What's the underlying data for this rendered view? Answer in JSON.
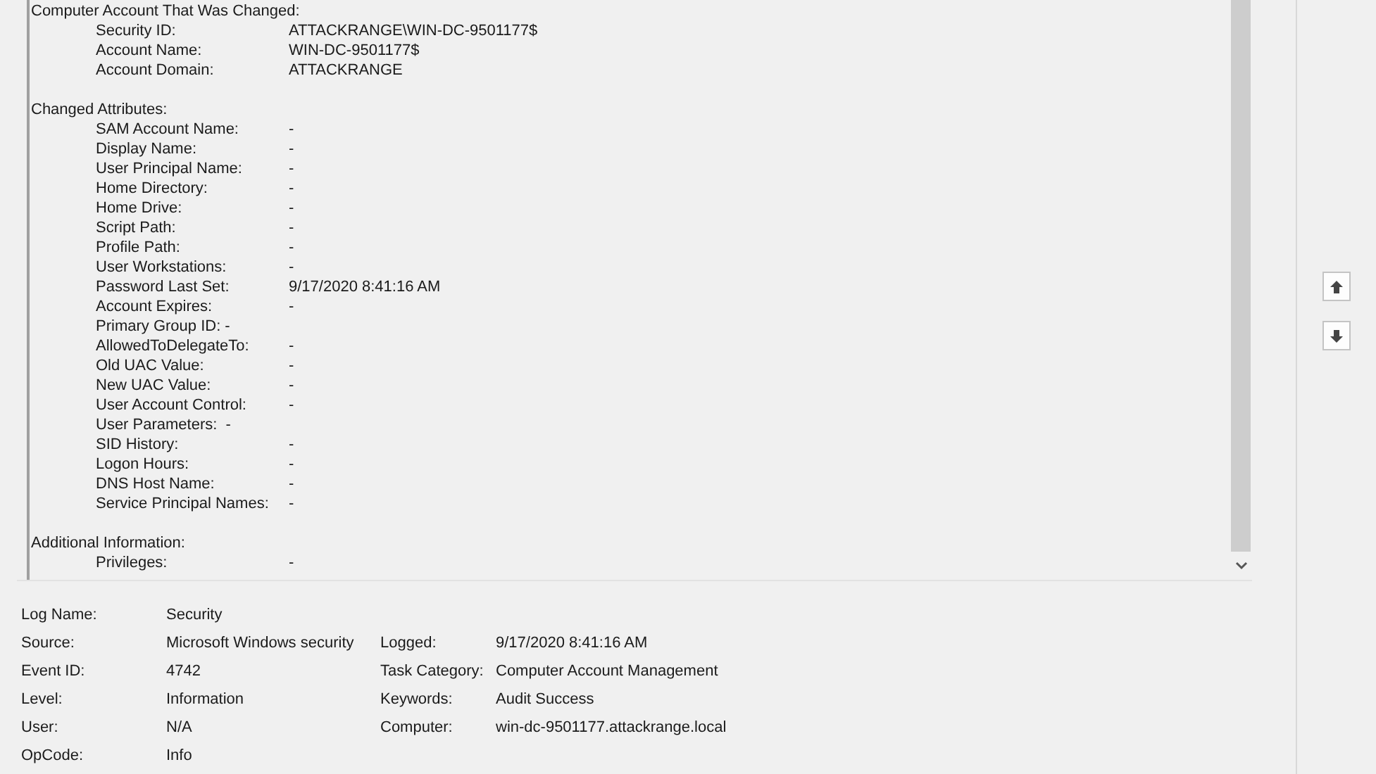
{
  "description": {
    "sections": [
      {
        "heading": "Computer Account That Was Changed:",
        "fields": [
          {
            "label": "Security ID:",
            "value": "ATTACKRANGE\\WIN-DC-9501177$",
            "kind": "column"
          },
          {
            "label": "Account Name:",
            "value": "WIN-DC-9501177$",
            "kind": "column"
          },
          {
            "label": "Account Domain:",
            "value": "ATTACKRANGE",
            "kind": "column"
          }
        ]
      },
      {
        "heading": "Changed Attributes:",
        "fields": [
          {
            "label": "SAM Account Name:",
            "value": "-",
            "kind": "column"
          },
          {
            "label": "Display Name:",
            "value": "-",
            "kind": "column"
          },
          {
            "label": "User Principal Name:",
            "value": "-",
            "kind": "column"
          },
          {
            "label": "Home Directory:",
            "value": "-",
            "kind": "column"
          },
          {
            "label": "Home Drive:",
            "value": "-",
            "kind": "column"
          },
          {
            "label": "Script Path:",
            "value": "-",
            "kind": "column"
          },
          {
            "label": "Profile Path:",
            "value": "-",
            "kind": "column"
          },
          {
            "label": "User Workstations:",
            "value": "-",
            "kind": "column"
          },
          {
            "label": "Password Last Set:",
            "value": "9/17/2020 8:41:16 AM",
            "kind": "column"
          },
          {
            "label": "Account Expires:",
            "value": "-",
            "kind": "column"
          },
          {
            "text": "Primary Group ID: -",
            "kind": "inline"
          },
          {
            "label": "AllowedToDelegateTo:",
            "value": "-",
            "kind": "column"
          },
          {
            "label": "Old UAC Value:",
            "value": "-",
            "kind": "column"
          },
          {
            "label": "New UAC Value:",
            "value": "-",
            "kind": "column"
          },
          {
            "label": "User Account Control:",
            "value": "-",
            "kind": "column"
          },
          {
            "text": "User Parameters:  -",
            "kind": "inline"
          },
          {
            "label": "SID History:",
            "value": "-",
            "kind": "column"
          },
          {
            "label": "Logon Hours:",
            "value": "-",
            "kind": "column"
          },
          {
            "label": "DNS Host Name:",
            "value": "-",
            "kind": "column"
          },
          {
            "label": "Service Principal Names:",
            "value": "-",
            "kind": "column"
          }
        ]
      },
      {
        "heading": "Additional Information:",
        "fields": [
          {
            "label": "Privileges:",
            "value": "-",
            "kind": "column"
          }
        ]
      }
    ]
  },
  "details": [
    [
      {
        "label": "Log Name:",
        "value": "Security"
      }
    ],
    [
      {
        "label": "Source:",
        "value": "Microsoft Windows security"
      },
      {
        "label": "Logged:",
        "value": "9/17/2020 8:41:16 AM"
      }
    ],
    [
      {
        "label": "Event ID:",
        "value": "4742"
      },
      {
        "label": "Task Category:",
        "value": "Computer Account Management"
      }
    ],
    [
      {
        "label": "Level:",
        "value": "Information"
      },
      {
        "label": "Keywords:",
        "value": "Audit Success"
      }
    ],
    [
      {
        "label": "User:",
        "value": "N/A"
      },
      {
        "label": "Computer:",
        "value": "win-dc-9501177.attackrange.local"
      }
    ],
    [
      {
        "label": "OpCode:",
        "value": "Info"
      }
    ]
  ]
}
